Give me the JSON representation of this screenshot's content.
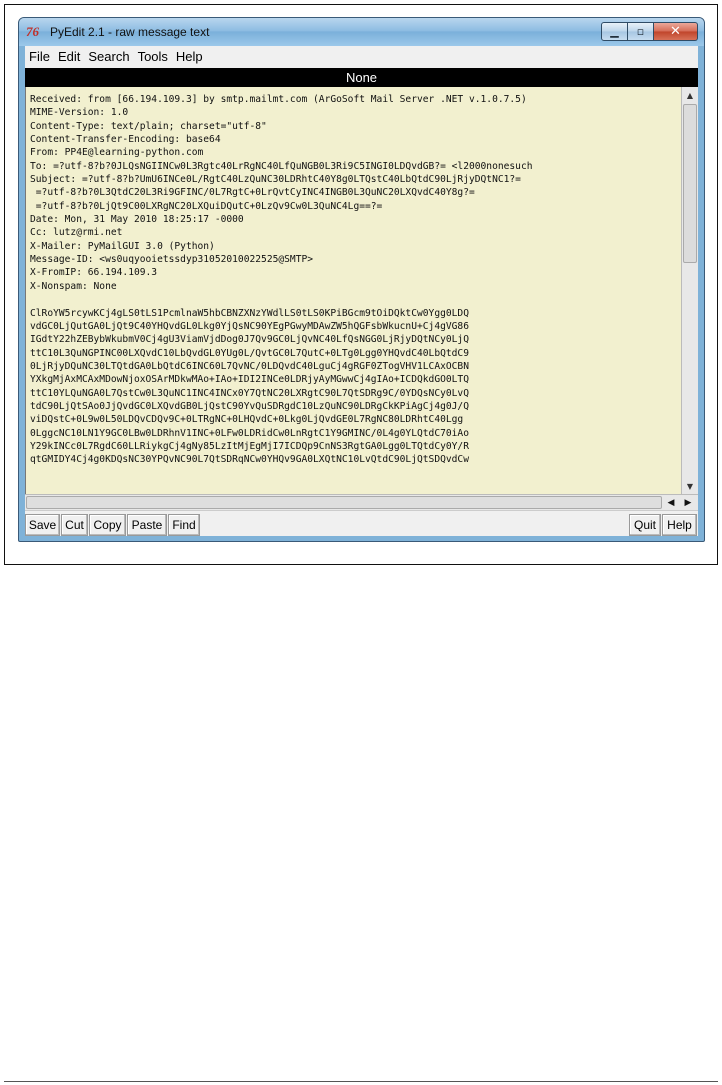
{
  "window": {
    "title": "PyEdit 2.1 - raw message text",
    "app_icon": "76"
  },
  "controls": {
    "minimize_glyph": "▁",
    "maximize_glyph": "▫",
    "close_glyph": "✕"
  },
  "menu": [
    "File",
    "Edit",
    "Search",
    "Tools",
    "Help"
  ],
  "name_bar": "None",
  "text_lines": [
    "Received: from [66.194.109.3] by smtp.mailmt.com (ArGoSoft Mail Server .NET v.1.0.7.5)",
    "MIME-Version: 1.0",
    "Content-Type: text/plain; charset=\"utf-8\"",
    "Content-Transfer-Encoding: base64",
    "From: PP4E@learning-python.com",
    "To: =?utf-8?b?0JLQsNGIINCw0L3Rgtc40LrRgNC40LfQuNGB0L3Ri9C5INGI0LDQvdGB?= <l2000nonesuch",
    "Subject: =?utf-8?b?UmU6INCe0L/RgtC40LzQuNC30LDRhtC40Y8g0LTQstC40LbQtdC90LjRjyDQtNC1?=",
    " =?utf-8?b?0L3QtdC20L3Ri9GFINC/0L7RgtC+0LrQvtCyINC4INGB0L3QuNC20LXQvdC40Y8g?=",
    " =?utf-8?b?0LjQt9C00LXRgNC20LXQuiDQutC+0LzQv9Cw0L3QuNC4Lg==?=",
    "Date: Mon, 31 May 2010 18:25:17 -0000",
    "Cc: lutz@rmi.net",
    "X-Mailer: PyMailGUI 3.0 (Python)",
    "Message-ID: <ws0uqyooietssdyp31052010022525@SMTP>",
    "X-FromIP: 66.194.109.3",
    "X-Nonspam: None",
    "",
    "ClRoYW5rcywKCj4gLS0tLS1PcmlnaW5hbCBNZXNzYWdlLS0tLS0KPiBGcm9tOiDQktCw0Ygg0LDQ",
    "vdGC0LjQutGA0LjQt9C40YHQvdGL0Lkg0YjQsNC90YEgPGwyMDAwZW5hQGFsbWkucnU+Cj4gVG86",
    "IGdtY22hZEBybWkubmV0Cj4gU3ViamVjdDog0J7Qv9GC0LjQvNC40LfQsNGG0LjRjyDQtNCy0LjQ",
    "ttC10L3QuNGPINC00LXQvdC10LbQvdGL0YUg0L/QvtGC0L7QutC+0LTg0Lgg0YHQvdC40LbQtdC9",
    "0LjRjyDQuNC30LTQtdGA0LbQtdC6INC60L7QvNC/0LDQvdC40LguCj4gRGF0ZTogVHV1LCAxOCBN",
    "YXkgMjAxMCAxMDowNjoxOSArMDkwMAo+IAo+IDI2INCe0LDRjyAyMGwwCj4gIAo+ICDQkdGO0LTQ",
    "ttC10YLQuNGA0L7QstCw0L3QuNC1INC4INCx0Y7QtNC20LXRgtC90L7QtSDRg9C/0YDQsNCy0LvQ",
    "tdC90LjQtSAo0JjQvdGC0LXQvdGB0LjQstC90YvQuSDRgdC10LzQuNC90LDRgCkKPiAgCj4g0J/Q",
    "viDQstC+0L9w0L50LDQvCDQv9C+0LTRgNC+0LHQvdC+0Lkg0LjQvdGE0L7RgNC80LDRhtC40Lgg",
    "0LggcNC10LN1Y9GC0LBw0LDRhnV1INC+0LFw0LDRidCw0LnRgtC1Y9GMINC/0L4g0YLQtdC70iAo",
    "Y29kINCc0L7RgdC60LLRiykgCj4gNy85LzItMjEgMjI7ICDQp9CnNS3RgtGA0Lgg0LTQtdCy0Y/R",
    "qtGMIDY4Cj4g0KDQsNC30YPQvNC90L7QtSDRqNCw0YHQv9GA0LXQtNC10LvQtdC90LjQtSDQvdCw"
  ],
  "scroll": {
    "up_glyph": "▲",
    "down_glyph": "▼",
    "left_glyph": "◀",
    "right_glyph": "▶"
  },
  "toolbar": {
    "left": [
      "Save",
      "Cut",
      "Copy",
      "Paste",
      "Find"
    ],
    "right": [
      "Quit",
      "Help"
    ]
  }
}
